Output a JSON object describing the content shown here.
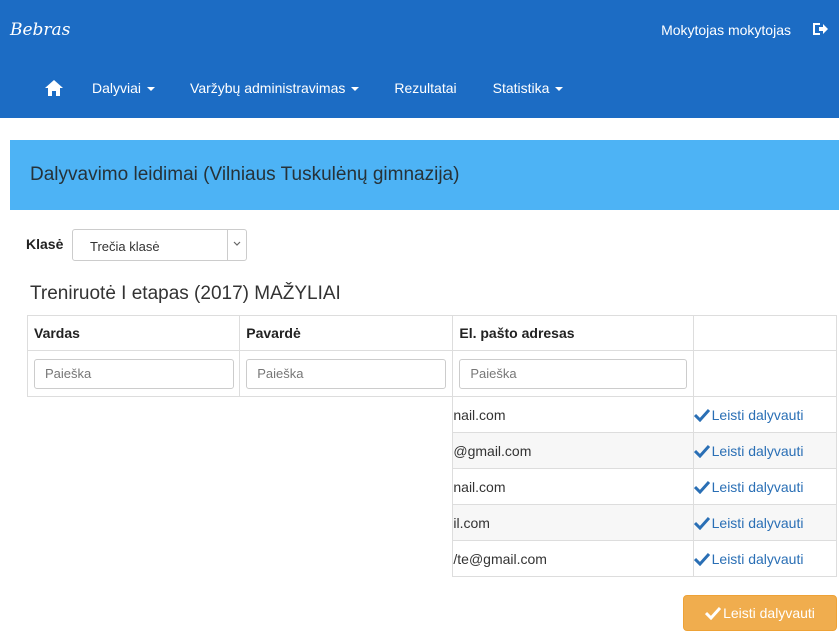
{
  "brand": "Bebras",
  "user_name": "Mokytojas mokytojas",
  "nav": {
    "participants": "Dalyviai",
    "admin": "Varžybų administravimas",
    "results": "Rezultatai",
    "statistics": "Statistika"
  },
  "panel_title": "Dalyvavimo leidimai (Vilniaus Tuskulėnų gimnazija)",
  "class_label": "Klasė",
  "class_selected": "Trečia klasė",
  "stage_title": "Treniruotė I etapas (2017) MAŽYLIAI",
  "table": {
    "headers": [
      "Vardas",
      "Pavardė",
      "El. pašto adresas",
      ""
    ],
    "search_placeholder": "Paieška",
    "rows": [
      {
        "email": "nail.com",
        "action": "Leisti dalyvauti"
      },
      {
        "email": "@gmail.com",
        "action": "Leisti dalyvauti"
      },
      {
        "email": "nail.com",
        "action": "Leisti dalyvauti"
      },
      {
        "email": "il.com",
        "action": "Leisti dalyvauti"
      },
      {
        "email": "/te@gmail.com",
        "action": "Leisti dalyvauti"
      }
    ]
  },
  "submit_label": "Leisti dalyvauti",
  "colors": {
    "topbar": "#1c6cc4",
    "panel": "#4db3f5",
    "link": "#2a6fb5",
    "button": "#f0ad4e"
  },
  "icons": {
    "home": "home-icon",
    "logout": "logout-icon",
    "check": "check-icon",
    "dropdown": "chevron-down-icon"
  }
}
